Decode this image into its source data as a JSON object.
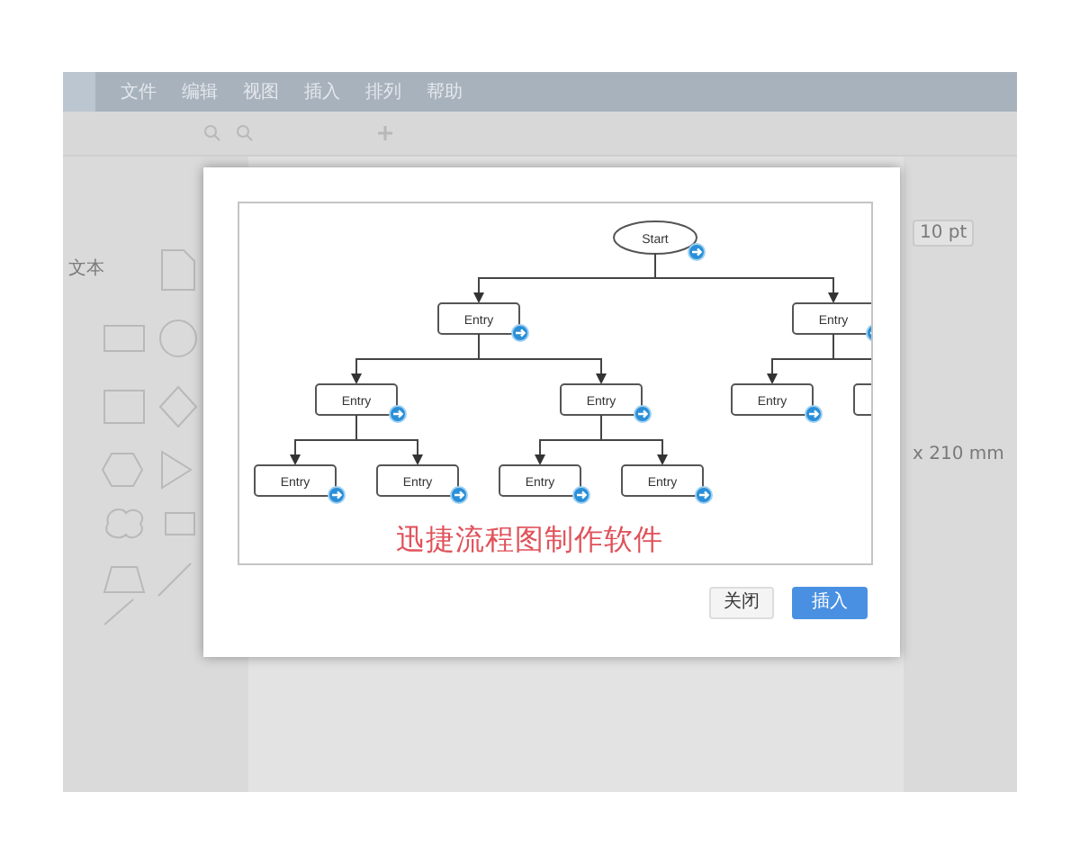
{
  "menu_bar": {
    "items": [
      "文件",
      "编辑",
      "视图",
      "插入",
      "排列",
      "帮助"
    ]
  },
  "sidebar": {
    "labels": [
      "文本"
    ]
  },
  "format_panel": {
    "font_size": "10 pt",
    "page_size": "x 210 mm"
  },
  "dialog": {
    "preview": {
      "flowchart": {
        "kind": "terminal",
        "label": "Start",
        "children": [
          {
            "kind": "process",
            "label": "Entry",
            "children": [
              {
                "kind": "process",
                "label": "Entry",
                "children": [
                  {
                    "kind": "process",
                    "label": "Entry"
                  },
                  {
                    "kind": "process",
                    "label": "Entry"
                  }
                ]
              },
              {
                "kind": "process",
                "label": "Entry",
                "children": [
                  {
                    "kind": "process",
                    "label": "Entry"
                  },
                  {
                    "kind": "process",
                    "label": "Entry"
                  }
                ]
              }
            ]
          },
          {
            "kind": "process",
            "label": "Entry",
            "children": [
              {
                "kind": "process",
                "label": "Entry"
              },
              {
                "kind": "process"
              }
            ]
          }
        ]
      },
      "caption": "迅捷流程图制作软件"
    },
    "buttons": [
      {
        "label": "关闭",
        "kind": "secondary"
      },
      {
        "label": "插入",
        "kind": "primary"
      }
    ]
  }
}
